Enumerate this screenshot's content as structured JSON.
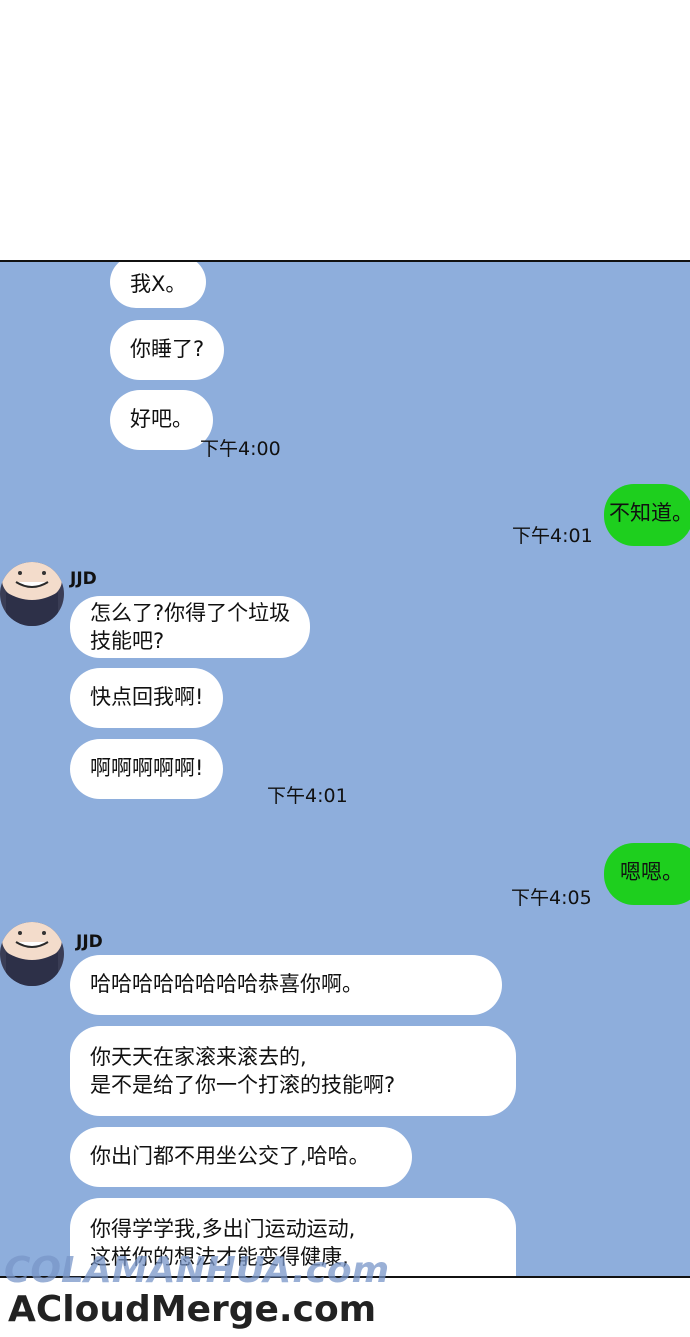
{
  "messages_a": [
    "我X。",
    "你睡了?",
    "好吧。"
  ],
  "time_a": "下午4:00",
  "me_1": "不知道。",
  "time_me_1": "下午4:01",
  "sender_1": "JJD",
  "messages_b": [
    "怎么了?你得了个垃圾\n技能吧?",
    "快点回我啊!",
    "啊啊啊啊啊!"
  ],
  "time_b": "下午4:01",
  "me_2": "嗯嗯。",
  "time_me_2": "下午4:05",
  "sender_2": "JJD",
  "messages_c": [
    "哈哈哈哈哈哈哈哈恭喜你啊。",
    "你天天在家滚来滚去的,\n是不是给了你一个打滚的技能啊?",
    "你出门都不用坐公交了,哈哈。",
    "你得学学我,多出门运动运动,\n这样你的想法才能变得健康,"
  ],
  "watermarks": [
    "COLAMANHUA.com",
    "ACloudMerge.com"
  ],
  "colors": {
    "panel": "#8eaedc",
    "my_bubble": "#1ecf1e",
    "their_bubble": "#ffffff"
  }
}
